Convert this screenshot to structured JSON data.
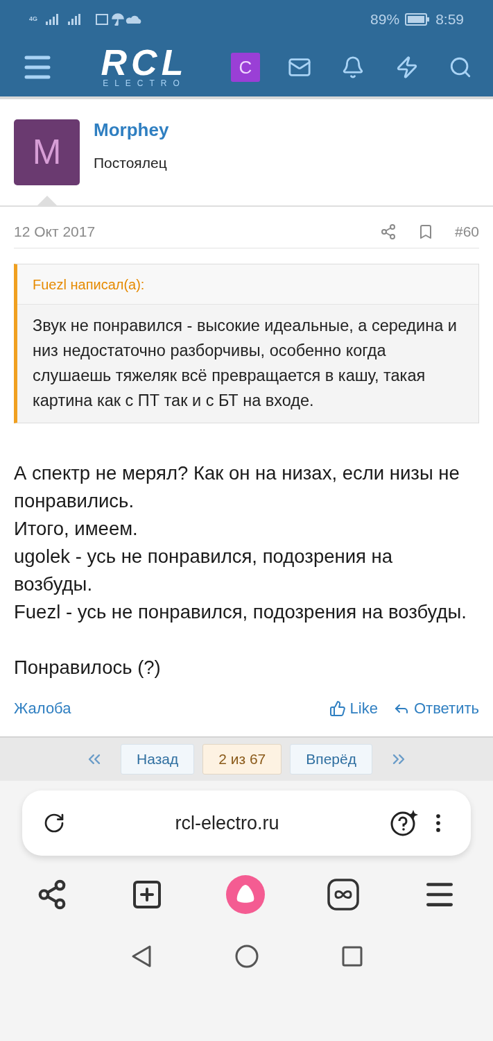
{
  "status_bar": {
    "network": "4G",
    "battery": "89%",
    "time": "8:59"
  },
  "header": {
    "logo": "RCL",
    "logo_sub": "ELECTRO",
    "avatar_letter": "C"
  },
  "post": {
    "avatar_letter": "M",
    "author": "Morphey",
    "role": "Постоялец",
    "date": "12 Окт 2017",
    "number": "#60",
    "quote": {
      "author": "Fuezl написал(а):",
      "text": "Звук не понравился - высокие идеальные, а середина и низ недостаточно разборчивы, особенно когда слушаешь тяжеляк всё превращается в кашу, такая картина как с ПТ так и с БТ на входе."
    },
    "paragraph_groups": [
      [
        "А спектр не мерял? Как он на низах, если низы не понравились.",
        "Итого, имеем.",
        "ugolek - усь не понравился, подозрения на возбуды.",
        "Fuezl - усь не понравился, подозрения на возбуды."
      ],
      [
        "Понравилось (?)"
      ]
    ],
    "report": "Жалоба",
    "like": "Like",
    "reply": "Ответить"
  },
  "pagination": [
    {
      "label": "Назад",
      "selected": false
    },
    {
      "label": "2 из 67",
      "selected": true
    },
    {
      "label": "Вперёд",
      "selected": false
    }
  ],
  "browser": {
    "url": "rcl-electro.ru"
  }
}
